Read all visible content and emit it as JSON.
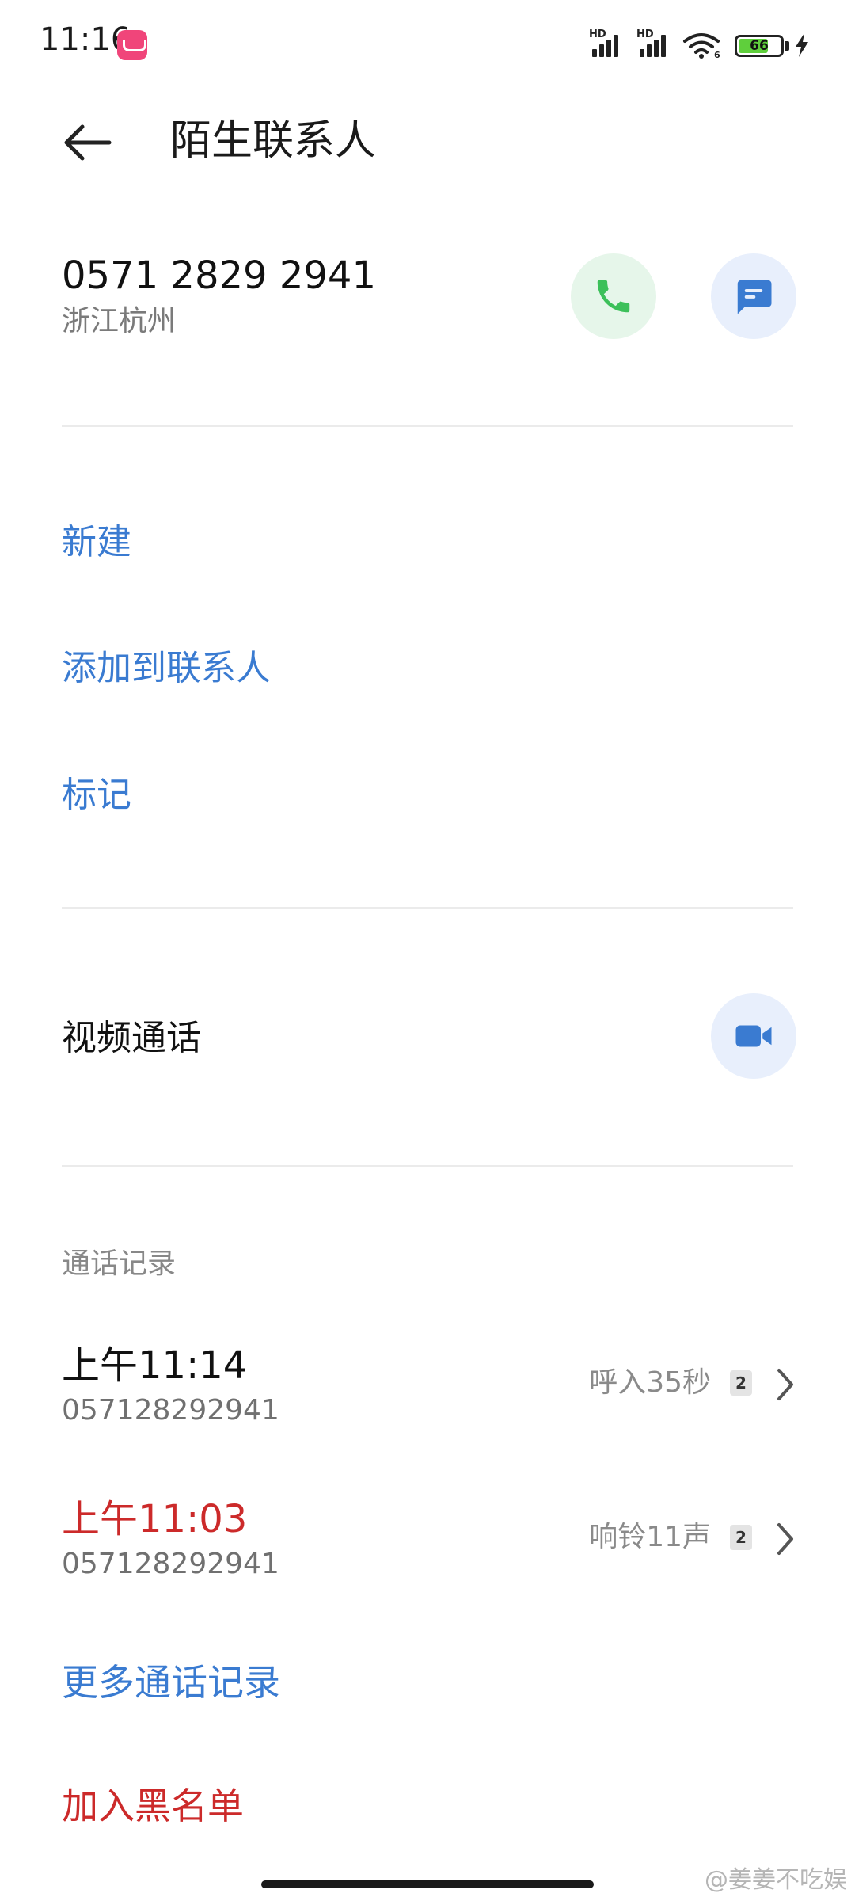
{
  "status_bar": {
    "time": "11:16",
    "network1": "HD",
    "network2": "HD",
    "battery": "66",
    "wifi_sub": "6"
  },
  "header": {
    "title": "陌生联系人"
  },
  "contact": {
    "number": "0571 2829 2941",
    "location": "浙江杭州"
  },
  "actions": {
    "new": "新建",
    "add_to_contacts": "添加到联系人",
    "mark": "标记"
  },
  "video": {
    "label": "视频通话"
  },
  "call_log": {
    "label": "通话记录",
    "records": [
      {
        "time": "上午11:14",
        "number": "057128292941",
        "status": "呼入35秒",
        "sim": "2",
        "missed": false
      },
      {
        "time": "上午11:03",
        "number": "057128292941",
        "status": "响铃11声",
        "sim": "2",
        "missed": true
      }
    ],
    "more": "更多通话记录"
  },
  "blacklist": "加入黑名单",
  "watermark": "@姜姜不吃娱",
  "colors": {
    "accent_blue": "#3a7bd1",
    "danger_red": "#cc2a2a",
    "call_green": "#3cc05a"
  }
}
